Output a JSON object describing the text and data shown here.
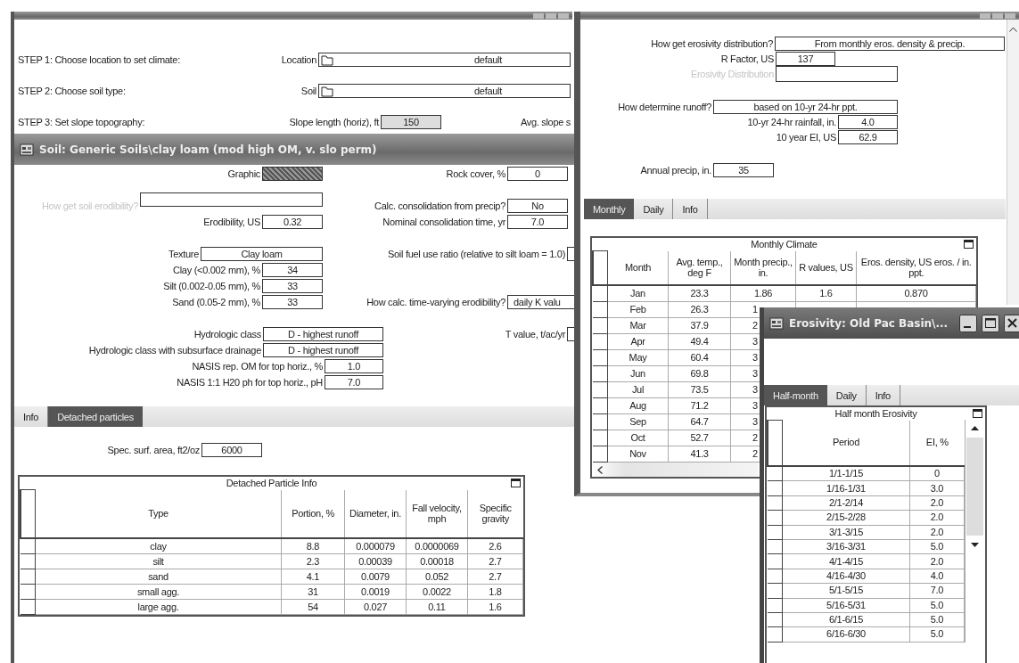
{
  "main_window": {
    "steps": [
      {
        "label": "STEP 1: Choose location to set climate:",
        "field_label": "Location",
        "value": "default",
        "kind": "picker"
      },
      {
        "label": "STEP 2: Choose soil type:",
        "field_label": "Soil",
        "value": "default",
        "kind": "picker"
      },
      {
        "label": "STEP 3: Set slope topography:",
        "field_label": "Slope length (horiz), ft",
        "value": "150",
        "kind": "number",
        "trailing_label": "Avg. slope s"
      }
    ]
  },
  "soil_window": {
    "title": "Soil:  Generic Soils\\clay loam (mod high OM, v. slo perm)",
    "sections": [
      [
        {
          "left": {
            "label": "Graphic",
            "kind": "graphic"
          },
          "right": {
            "label": "Rock cover, %",
            "value": "0",
            "kind": "box"
          }
        }
      ],
      [
        {
          "left": {
            "label": "How get soil erodibility?",
            "kind": "disabled-input"
          },
          "right": {
            "label": "Calc. consolidation from precip?",
            "value": "No",
            "kind": "box"
          }
        },
        {
          "left": {
            "label": "Erodibility, US",
            "value": "0.32",
            "kind": "box"
          },
          "right": {
            "label": "Nominal consolidation time, yr",
            "value": "7.0",
            "kind": "box"
          }
        }
      ],
      [
        {
          "left": {
            "label": "Texture",
            "value": "Clay loam",
            "kind": "choice"
          },
          "right": {
            "label": "Soil fuel use ratio (relative to silt loam = 1.0)",
            "kind": "box-cut"
          }
        },
        {
          "left": {
            "label": "Clay (<0.002 mm), %",
            "value": "34",
            "kind": "box"
          }
        },
        {
          "left": {
            "label": "Silt (0.002-0.05 mm), %",
            "value": "33",
            "kind": "box"
          }
        },
        {
          "left": {
            "label": "Sand (0.05-2 mm), %",
            "value": "33",
            "kind": "box"
          },
          "right": {
            "label": "How calc. time-varying erodibility?",
            "value": "daily K valu",
            "kind": "choice-cut"
          }
        }
      ],
      [
        {
          "left": {
            "label": "Hydrologic class",
            "value": "D - highest runoff",
            "kind": "class"
          },
          "right": {
            "label": "T value, t/ac/yr",
            "kind": "box-cut"
          }
        },
        {
          "left": {
            "label": "Hydrologic class with subsurface drainage",
            "value": "D - highest runoff",
            "kind": "class"
          }
        },
        {
          "left": {
            "label": "NASIS rep. OM for top horiz., %",
            "value": "1.0",
            "kind": "far-box"
          }
        },
        {
          "left": {
            "label": "NASIS 1:1 H20 ph for top horiz., pH",
            "value": "7.0",
            "kind": "far-box"
          }
        }
      ]
    ],
    "tabs": [
      {
        "label": "Info",
        "selected": false
      },
      {
        "label": "Detached particles",
        "selected": true
      }
    ],
    "spec_field": {
      "label": "Spec. surf. area, ft2/oz",
      "value": "6000"
    },
    "table": {
      "title": "Detached Particle Info",
      "columns": [
        "Type",
        "Portion, %",
        "Diameter, in.",
        "Fall velocity, mph",
        "Specific gravity"
      ],
      "rows": [
        [
          "clay",
          "8.8",
          "0.000079",
          "0.0000069",
          "2.6"
        ],
        [
          "silt",
          "2.3",
          "0.00039",
          "0.00018",
          "2.7"
        ],
        [
          "sand",
          "4.1",
          "0.0079",
          "0.052",
          "2.7"
        ],
        [
          "small agg.",
          "31",
          "0.0019",
          "0.0022",
          "1.8"
        ],
        [
          "large agg.",
          "54",
          "0.027",
          "0.11",
          "1.6"
        ]
      ]
    }
  },
  "climate_window": {
    "sections": [
      [
        {
          "label": "How get erosivity distribution?",
          "value": "From monthly eros. density & precip.",
          "kind": "long-choice"
        },
        {
          "label": "R Factor, US",
          "value": "137",
          "kind": "box"
        },
        {
          "label": "Erosivity Distribution",
          "kind": "disabled-input"
        }
      ],
      [
        {
          "label": "How determine runoff?",
          "value": "based on 10-yr 24-hr ppt.",
          "kind": "choice"
        },
        {
          "label": "10-yr 24-hr rainfall, in.",
          "value": "4.0",
          "kind": "narrow-box"
        },
        {
          "label": "10 year EI, US",
          "value": "62.9",
          "kind": "narrow-box"
        }
      ],
      [
        {
          "label": "Annual precip, in.",
          "value": "35",
          "kind": "short-box"
        }
      ]
    ],
    "tabs": [
      {
        "label": "Monthly",
        "selected": true
      },
      {
        "label": "Daily",
        "selected": false
      },
      {
        "label": "Info",
        "selected": false
      }
    ],
    "table": {
      "title": "Monthly Climate",
      "columns": [
        "Month",
        "Avg. temp., deg F",
        "Month precip., in.",
        "R values, US",
        "Eros. density, US eros. / in. ppt."
      ],
      "rows": [
        [
          "Jan",
          "23.3",
          "1.86",
          "1.6",
          "0.870"
        ],
        [
          "Feb",
          "26.3",
          "1"
        ],
        [
          "Mar",
          "37.9",
          "2"
        ],
        [
          "Apr",
          "49.4",
          "3"
        ],
        [
          "May",
          "60.4",
          "3"
        ],
        [
          "Jun",
          "69.8",
          "3"
        ],
        [
          "Jul",
          "73.5",
          "3"
        ],
        [
          "Aug",
          "71.2",
          "3"
        ],
        [
          "Sep",
          "64.7",
          "3"
        ],
        [
          "Oct",
          "52.7",
          "2"
        ],
        [
          "Nov",
          "41.3",
          "2"
        ]
      ]
    }
  },
  "erosivity_window": {
    "title": "Erosivity:  Old Pac Basin\\...",
    "tabs": [
      {
        "label": "Half-month",
        "selected": true
      },
      {
        "label": "Daily",
        "selected": false
      },
      {
        "label": "Info",
        "selected": false
      }
    ],
    "table": {
      "title": "Half month Erosivity",
      "columns": [
        "Period",
        "EI, %"
      ],
      "rows": [
        [
          "1/1-1/15",
          "0"
        ],
        [
          "1/16-1/31",
          "3.0"
        ],
        [
          "2/1-2/14",
          "2.0"
        ],
        [
          "2/15-2/28",
          "2.0"
        ],
        [
          "3/1-3/15",
          "2.0"
        ],
        [
          "3/16-3/31",
          "5.0"
        ],
        [
          "4/1-4/15",
          "2.0"
        ],
        [
          "4/16-4/30",
          "4.0"
        ],
        [
          "5/1-5/15",
          "7.0"
        ],
        [
          "5/16-5/31",
          "5.0"
        ],
        [
          "6/1-6/15",
          "5.0"
        ],
        [
          "6/16-6/30",
          "5.0"
        ]
      ]
    }
  }
}
